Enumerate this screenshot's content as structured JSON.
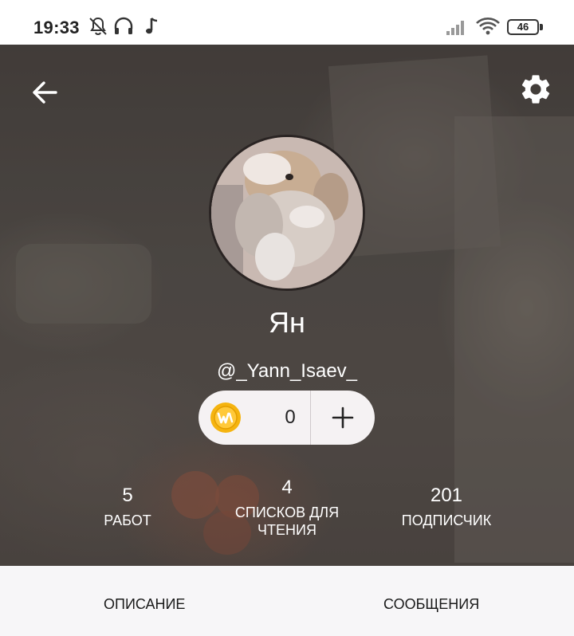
{
  "status_bar": {
    "time": "19:33",
    "battery": "46",
    "icons": [
      "bell-off-icon",
      "headphones-icon",
      "music-note-icon",
      "signal-icon",
      "wifi-icon",
      "battery-icon"
    ]
  },
  "header": {
    "back_icon": "arrow-left-icon",
    "settings_icon": "gear-icon"
  },
  "profile": {
    "display_name": "Ян",
    "username": "@_Yann_Isaev_",
    "coins": "0"
  },
  "stats": [
    {
      "value": "5",
      "label": "РАБОТ"
    },
    {
      "value": "4",
      "label": "СПИСКОВ ДЛЯ ЧТЕНИЯ"
    },
    {
      "value": "201",
      "label": "ПОДПИСЧИК"
    }
  ],
  "tabs": [
    {
      "label": "ОПИСАНИЕ"
    },
    {
      "label": "СООБЩЕНИЯ"
    }
  ],
  "colors": {
    "accent_coin": "#f5b40f",
    "pill_bg": "#f5f2f3",
    "tabs_bg": "#f7f6f8"
  }
}
